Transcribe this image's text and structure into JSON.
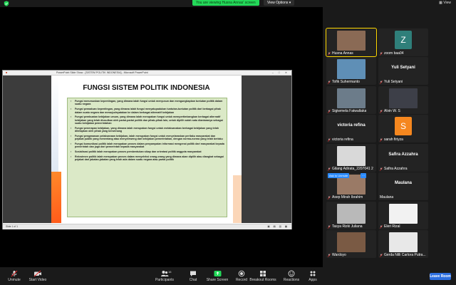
{
  "top": {
    "viewing_banner": "You are viewing Husna Annas' screen",
    "view_options": "View Options ▾",
    "view": "View",
    "colors": {
      "banner": "#23d959",
      "shield": "#23d959"
    }
  },
  "ppt": {
    "title": "PowerPoint Slide Show - [SISTEM POLITIK INDONESIA] - Microsoft PowerPoint",
    "window_controls": "–  □  ✕",
    "status_left": "Slide 1 of 1",
    "status_right": "▣ ▤ ▥ ▦",
    "slide_title": "FUNGSI SISTEM POLITIK INDONESIA",
    "bullets": [
      "Fungsi merumuskan kepentingan, yang dimana ialah fungsi untuk menyusun dan mengungkapkan tuntutan politik dalam suatu negara",
      "Fungsi pemaduan kepentingan, yang dimana ialah fungsi menyatupadukan tuntutan-tuntutan politik dari berbagai pihak dalam suatu negara dan mewujudnyatakan ke dalam berbagai alternatif kebijakan",
      "Fungsi pembuatan kebijakan umum, yang dimana ialah merupakan fungsi untuk mempertimbangkan berbagai alternatif kebijakan yang telah diusulkan oleh partai-partai politik dan pihak-pihak lain, untuk dipilih salah satu diantaranya sebagai suatu kebijakan pemerintahan",
      "Fungsi penerapan kebijakan, yang dimana ialah merupakan fungsi untuk melaksanakan berbagai kebijakan yang telah ditetapkan oleh pihak yang berwenang",
      "Fungsi pengawasan pelaksanaan kebijakan, ialah merupakan fungsi untuk menyelaraskan perilaku masyarakat dan pejabat publik yang menentang atau menyeleweng dari kebijakan pemerintahan, dengan norma-norma yang telah berlaku",
      "Fungsi komunikasi politik ialah merupakan proses dalam penyampaian informasi mengenai politik dari masyarakat kepada pemerintah dan juga dari pemerintah kepada masyarakat",
      "Sosialisasi politik ialah merupakan proses pembentukan sikap dan orientasi politik anggota masyarakat",
      "Rekrutmen politik ialah merupakan proses dalam menyeleksi orang-orang yang dimana akan dipilih atau diangkat sebagai pejabat dari jabatan-jabatan yang telah ada dalam suatu negara atau partai politik"
    ]
  },
  "gallery": {
    "tiles": [
      {
        "name": "Husna Annas",
        "type": "photo",
        "muted": true,
        "active": true,
        "color": "#8a6a55"
      },
      {
        "name": "zoom baa04",
        "type": "avatar",
        "letter": "Z",
        "color": "#2f7f7a",
        "muted": true
      },
      {
        "name": "Tofik Suhermanto",
        "type": "photo",
        "muted": true,
        "color": "#5f8fb6"
      },
      {
        "name": "Yuli Setyani",
        "type": "bigname",
        "muted": true
      },
      {
        "name": "Sigiwmela Fatwaltaka",
        "type": "photo",
        "muted": true,
        "color": "#6c7c8a"
      },
      {
        "name": "Alvin W. S",
        "type": "photo",
        "muted": true,
        "color": "#3d3f48"
      },
      {
        "name": "victoria refina",
        "type": "bigname",
        "muted": true
      },
      {
        "name": "sarah firiyza",
        "type": "avatar",
        "letter": "S",
        "color": "#f5871f",
        "muted": true
      },
      {
        "name": "Gilang Adirata_2207041 2",
        "type": "photo",
        "muted": true,
        "color": "#d9d9d9"
      },
      {
        "name": "Safira Azzahra",
        "type": "bigname",
        "muted": true
      },
      {
        "name": "Asep Mirah Ibrahim",
        "type": "photo",
        "muted": true,
        "color": "#9a7a66",
        "ask": true
      },
      {
        "name": "Maulana",
        "type": "bigname",
        "muted": false
      },
      {
        "name": "Tasya Rizki Juliana",
        "type": "photo",
        "muted": true,
        "color": "#b9b9b9"
      },
      {
        "name": "Eleri Rizal",
        "type": "photo",
        "muted": true,
        "color": "#f2f2f2"
      },
      {
        "name": "Wardoyo",
        "type": "photo",
        "muted": true,
        "color": "#7a5a44"
      },
      {
        "name": "Gerda Nilli Carlora Putra...",
        "type": "photo",
        "muted": true,
        "color": "#e8e8e8"
      }
    ],
    "ask_to_unmute": "Ask to Unmute",
    "more": "···"
  },
  "toolbar": {
    "unmute": "Unmute",
    "start_video": "Start Video",
    "participants": "Participants",
    "participants_count": "16",
    "chat": "Chat",
    "share_screen": "Share Screen",
    "record": "Record",
    "breakout_rooms": "Breakout Rooms",
    "reactions": "Reactions",
    "apps": "Apps",
    "leave": "Leave Room",
    "colors": {
      "share": "#23d959",
      "leave": "#2d6fe0"
    }
  }
}
